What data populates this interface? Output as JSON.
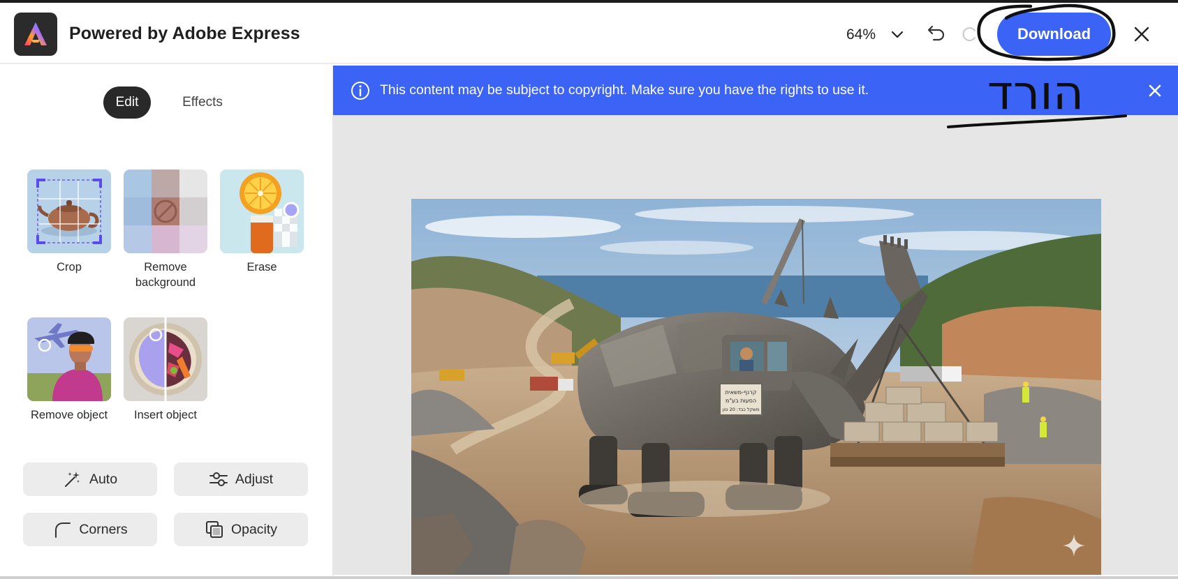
{
  "header": {
    "app_title": "Powered by Adobe Express",
    "zoom": "64%",
    "download_label": "Download",
    "handwritten_note": "הורד"
  },
  "left_panel": {
    "tabs": [
      {
        "label": "Edit",
        "active": true
      },
      {
        "label": "Effects",
        "active": false
      }
    ],
    "tools": [
      {
        "label": "Crop",
        "icon": "crop-teapot-thumbnail"
      },
      {
        "label": "Remove background",
        "icon": "remove-background-thumbnail"
      },
      {
        "label": "Erase",
        "icon": "erase-orange-thumbnail"
      },
      {
        "label": "Remove object",
        "icon": "remove-object-cyclist-thumbnail"
      },
      {
        "label": "Insert object",
        "icon": "insert-object-plate-thumbnail"
      }
    ],
    "actions": [
      {
        "label": "Auto",
        "icon": "magic-wand-icon"
      },
      {
        "label": "Adjust",
        "icon": "sliders-icon"
      },
      {
        "label": "Corners",
        "icon": "corner-radius-icon"
      },
      {
        "label": "Opacity",
        "icon": "opacity-icon"
      }
    ]
  },
  "canvas": {
    "banner_text": "This content may be subject to copyright. Make sure you have the rights to use it.",
    "image_sign_text": [
      "קרנף-משאית",
      "הסעות בע\"מ",
      "משקל כבד: 20 טון"
    ]
  },
  "colors": {
    "accent_blue": "#3b63f5",
    "dark_pill": "#292929",
    "canvas_bg": "#e6e6e6"
  }
}
